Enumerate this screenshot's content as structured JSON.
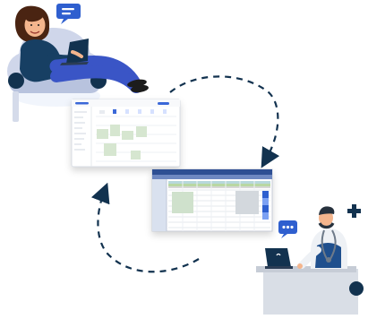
{
  "colors": {
    "navy": "#12324f",
    "brand_blue": "#2f5fcf",
    "chair": "#cfd6ea",
    "chair_shadow": "#b8c3de",
    "patient_top": "#173f63",
    "jeans": "#3a55c6",
    "skin": "#f4b58d",
    "hair": "#4a2412",
    "desk": "#d9dee6",
    "desk_shadow": "#c6ccd6",
    "calendar_green": "#b9d7a3",
    "calendar_teal": "#b7d8dc",
    "calendar_gray": "#d7d7d7"
  },
  "icons": {
    "patient_chat": "chat-message-icon",
    "doctor_chat": "typing-dots-icon",
    "plus": "medical-plus-icon",
    "sync_arrow": "sync-arrow-icon"
  }
}
